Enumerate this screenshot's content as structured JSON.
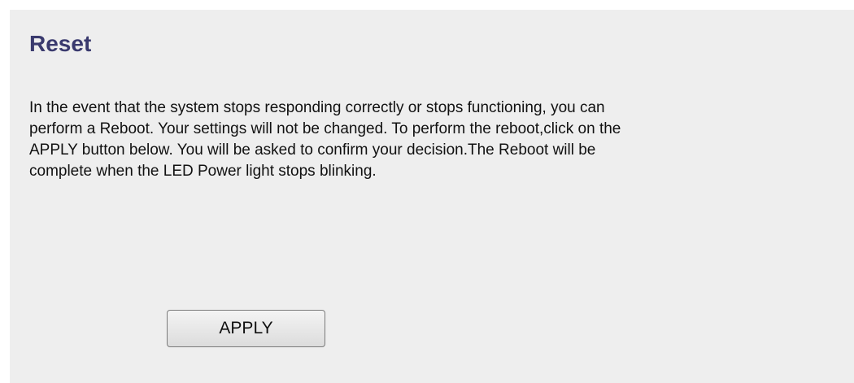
{
  "page": {
    "title": "Reset",
    "description": "In the event that the system stops responding correctly or stops functioning, you can\nperform a Reboot. Your settings will not be changed. To perform the reboot,click on the\nAPPLY button below. You will be asked to confirm your decision.The Reboot will be\ncomplete when the LED Power light stops blinking."
  },
  "actions": {
    "apply_label": "APPLY"
  },
  "colors": {
    "background": "#eeeeee",
    "title": "#3a3a6e"
  }
}
